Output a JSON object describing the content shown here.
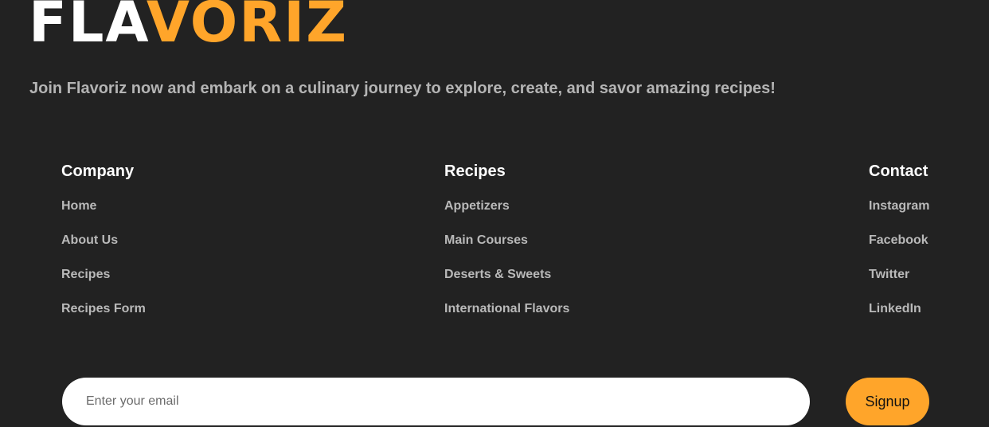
{
  "brand": {
    "logo_part1": "FLA",
    "logo_part2": "VORIZ",
    "tagline": "Join Flavoriz now and embark on a culinary journey to explore, create, and savor amazing recipes!"
  },
  "colors": {
    "background": "#222222",
    "accent": "#ffa52a",
    "heading": "#ffffff",
    "link": "#b9b9b9"
  },
  "footer": {
    "company": {
      "title": "Company",
      "links": [
        "Home",
        "About Us",
        "Recipes",
        "Recipes Form"
      ]
    },
    "recipes": {
      "title": "Recipes",
      "links": [
        "Appetizers",
        "Main Courses",
        "Deserts & Sweets",
        "International Flavors"
      ]
    },
    "contact": {
      "title": "Contact",
      "links": [
        "Instagram",
        "Facebook",
        "Twitter",
        "LinkedIn"
      ]
    }
  },
  "newsletter": {
    "email_placeholder": "Enter your email",
    "signup_label": "Signup"
  }
}
